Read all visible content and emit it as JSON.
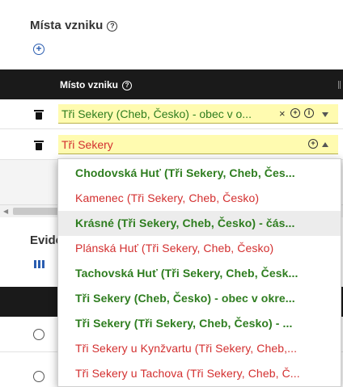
{
  "places_section": {
    "title": "Místa vzniku",
    "help_glyph": "?",
    "add_glyph": "+"
  },
  "grid": {
    "column_header": "Místo vzniku",
    "help_glyph": "?",
    "rows": [
      {
        "value": "Tři Sekery (Cheb, Česko) - obec v o...",
        "state": "selected",
        "controls": {
          "clear": "×",
          "add": "+",
          "info": "i"
        }
      },
      {
        "value": "Tři Sekery",
        "state": "editing",
        "controls": {
          "add": "+"
        }
      }
    ]
  },
  "evidence_section": {
    "title": "Evide"
  },
  "dropdown": {
    "options": [
      {
        "label": "Chodovská Huť (Tři Sekery, Cheb, Čes...",
        "style": "green"
      },
      {
        "label": "Kamenec (Tři Sekery, Cheb, Česko)",
        "style": "red"
      },
      {
        "label": "Krásné (Tři Sekery, Cheb, Česko) - čás...",
        "style": "green",
        "highlighted": true
      },
      {
        "label": "Plánská Huť (Tři Sekery, Cheb, Česko)",
        "style": "red"
      },
      {
        "label": "Tachovská Huť (Tři Sekery, Cheb, Česk...",
        "style": "green"
      },
      {
        "label": "Tři Sekery (Cheb, Česko) - obec v okre...",
        "style": "green"
      },
      {
        "label": "Tři Sekery (Tři Sekery, Cheb, Česko) - ...",
        "style": "green"
      },
      {
        "label": "Tři Sekery u Kynžvartu (Tři Sekery, Cheb,...",
        "style": "red"
      },
      {
        "label": "Tři Sekery u Tachova (Tři Sekery, Cheb, Č...",
        "style": "red"
      }
    ]
  },
  "colors": {
    "header_bg": "#1a1a1a",
    "field_highlight": "#fffbb0",
    "confirmed_green": "#2e7d1f",
    "unconfirmed_red": "#d32f2f",
    "accent_blue": "#2a5db0"
  },
  "icons": {
    "delete": "trash-icon",
    "add": "plus-circle-icon",
    "help": "question-circle-icon",
    "info": "info-circle-icon",
    "clear": "close-icon",
    "expand": "chevron-down-icon",
    "collapse": "chevron-up-icon",
    "columns": "columns-icon",
    "select": "radio-icon"
  }
}
